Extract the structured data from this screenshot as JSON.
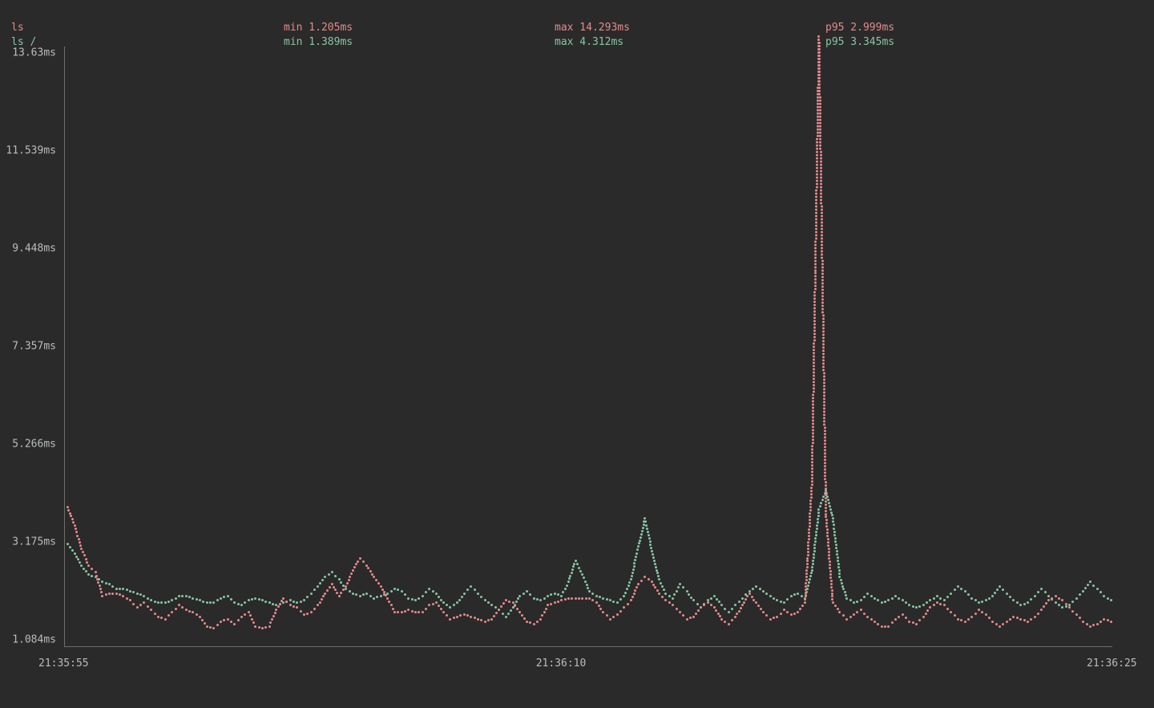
{
  "colors": {
    "ls": "#e38b8c",
    "ls_root": "#86c6a5"
  },
  "legend": {
    "rows": [
      {
        "name": "ls",
        "min": "min 1.205ms",
        "max": "max 14.293ms",
        "p95": "p95 2.999ms",
        "class": "c-ls"
      },
      {
        "name": "ls /",
        "min": "min 1.389ms",
        "max": "max 4.312ms",
        "p95": "p95 3.345ms",
        "class": "c-lsr"
      }
    ]
  },
  "yaxis": {
    "ticks": [
      "13.63ms",
      "11.539ms",
      "9.448ms",
      "7.357ms",
      "5.266ms",
      "3.175ms",
      "1.084ms"
    ]
  },
  "xaxis": {
    "ticks": [
      {
        "label": "21:35:55",
        "pos": "left"
      },
      {
        "label": "21:36:10",
        "pos": "center"
      },
      {
        "label": "21:36:25",
        "pos": "right"
      }
    ]
  },
  "chart_data": {
    "type": "line",
    "title": "",
    "xlabel": "",
    "ylabel": "",
    "ylim": [
      1.084,
      13.63
    ],
    "x_range": [
      "21:35:55",
      "21:36:25"
    ],
    "x_seconds": [
      0,
      0.2,
      0.4,
      0.6,
      0.8,
      1,
      1.2,
      1.4,
      1.6,
      1.8,
      2,
      2.2,
      2.4,
      2.6,
      2.8,
      3,
      3.2,
      3.4,
      3.6,
      3.8,
      4,
      4.2,
      4.4,
      4.6,
      4.8,
      5,
      5.2,
      5.4,
      5.6,
      5.8,
      6,
      6.2,
      6.4,
      6.6,
      6.8,
      7,
      7.2,
      7.4,
      7.6,
      7.8,
      8,
      8.2,
      8.4,
      8.6,
      8.8,
      9,
      9.2,
      9.4,
      9.6,
      9.8,
      10,
      10.2,
      10.4,
      10.6,
      10.8,
      11,
      11.2,
      11.4,
      11.6,
      11.8,
      12,
      12.2,
      12.4,
      12.6,
      12.8,
      13,
      13.2,
      13.4,
      13.6,
      13.8,
      14,
      14.2,
      14.4,
      14.6,
      14.8,
      15,
      15.2,
      15.4,
      15.6,
      15.8,
      16,
      16.2,
      16.4,
      16.6,
      16.8,
      17,
      17.2,
      17.4,
      17.6,
      17.8,
      18,
      18.2,
      18.4,
      18.6,
      18.8,
      19,
      19.2,
      19.4,
      19.6,
      19.8,
      20,
      20.2,
      20.4,
      20.6,
      20.8,
      21,
      21.2,
      21.4,
      21.6,
      21.8,
      22,
      22.2,
      22.4,
      22.6,
      22.8,
      23,
      23.2,
      23.4,
      23.6,
      23.8,
      24,
      24.2,
      24.4,
      24.6,
      24.8,
      25,
      25.2,
      25.4,
      25.6,
      25.8,
      26,
      26.2,
      26.4,
      26.6,
      26.8,
      27,
      27.2,
      27.4,
      27.6,
      27.8,
      28,
      28.2,
      28.4,
      28.6,
      28.8,
      29,
      29.2,
      29.4,
      29.6,
      29.8,
      30
    ],
    "series": [
      {
        "name": "ls",
        "color": "#e38b8c",
        "min": 1.205,
        "max": 14.293,
        "p95": 2.999,
        "values": [
          3.95,
          3.55,
          3.05,
          2.7,
          2.55,
          2.05,
          2.1,
          2.1,
          2.05,
          1.95,
          1.8,
          1.9,
          1.75,
          1.6,
          1.55,
          1.7,
          1.85,
          1.75,
          1.7,
          1.6,
          1.4,
          1.35,
          1.5,
          1.55,
          1.45,
          1.6,
          1.7,
          1.4,
          1.35,
          1.4,
          1.75,
          2.0,
          1.85,
          1.8,
          1.65,
          1.7,
          1.85,
          2.1,
          2.3,
          2.05,
          2.25,
          2.6,
          2.85,
          2.7,
          2.45,
          2.25,
          2.0,
          1.7,
          1.7,
          1.75,
          1.7,
          1.7,
          1.85,
          1.9,
          1.7,
          1.55,
          1.6,
          1.65,
          1.6,
          1.55,
          1.5,
          1.55,
          1.75,
          1.95,
          1.9,
          1.7,
          1.5,
          1.45,
          1.55,
          1.85,
          1.9,
          1.95,
          2.0,
          2.0,
          2.0,
          2.0,
          1.9,
          1.7,
          1.55,
          1.65,
          1.8,
          1.95,
          2.3,
          2.45,
          2.35,
          2.1,
          1.95,
          1.85,
          1.7,
          1.55,
          1.6,
          1.8,
          1.9,
          1.8,
          1.55,
          1.45,
          1.6,
          1.85,
          2.1,
          1.9,
          1.7,
          1.55,
          1.6,
          1.75,
          1.65,
          1.7,
          1.9,
          4.5,
          14.0,
          3.8,
          1.9,
          1.7,
          1.55,
          1.65,
          1.75,
          1.6,
          1.5,
          1.4,
          1.4,
          1.55,
          1.65,
          1.5,
          1.45,
          1.6,
          1.8,
          1.9,
          1.85,
          1.7,
          1.55,
          1.5,
          1.6,
          1.75,
          1.65,
          1.5,
          1.4,
          1.5,
          1.6,
          1.55,
          1.5,
          1.6,
          1.75,
          1.95,
          2.05,
          1.95,
          1.8,
          1.65,
          1.5,
          1.4,
          1.45,
          1.55,
          1.5
        ]
      },
      {
        "name": "ls /",
        "color": "#86c6a5",
        "min": 1.389,
        "max": 4.312,
        "p95": 3.345,
        "values": [
          3.15,
          2.95,
          2.7,
          2.5,
          2.45,
          2.35,
          2.3,
          2.2,
          2.2,
          2.15,
          2.1,
          2.05,
          1.95,
          1.9,
          1.9,
          1.95,
          2.05,
          2.05,
          2.0,
          1.95,
          1.9,
          1.9,
          2.0,
          2.05,
          1.9,
          1.85,
          1.95,
          2.0,
          1.95,
          1.9,
          1.85,
          1.9,
          1.95,
          1.9,
          1.95,
          2.1,
          2.25,
          2.45,
          2.55,
          2.4,
          2.2,
          2.1,
          2.05,
          2.1,
          2.0,
          2.05,
          2.1,
          2.2,
          2.15,
          2.0,
          1.95,
          2.05,
          2.2,
          2.1,
          1.9,
          1.8,
          1.9,
          2.1,
          2.25,
          2.1,
          1.95,
          1.85,
          1.75,
          1.6,
          1.8,
          2.05,
          2.15,
          2.0,
          1.95,
          2.05,
          2.1,
          2.05,
          2.35,
          2.8,
          2.5,
          2.15,
          2.05,
          2.0,
          1.95,
          1.9,
          2.05,
          2.4,
          3.1,
          3.7,
          3.0,
          2.4,
          2.1,
          2.0,
          2.3,
          2.15,
          1.95,
          1.8,
          1.95,
          2.05,
          1.85,
          1.7,
          1.85,
          2.0,
          2.15,
          2.25,
          2.15,
          2.05,
          1.95,
          1.9,
          2.05,
          2.1,
          2.0,
          2.6,
          3.9,
          4.3,
          3.7,
          2.45,
          2.0,
          1.9,
          1.95,
          2.1,
          2.0,
          1.9,
          1.95,
          2.05,
          1.95,
          1.85,
          1.8,
          1.85,
          1.95,
          2.05,
          1.95,
          2.1,
          2.25,
          2.15,
          2.0,
          1.9,
          1.95,
          2.05,
          2.25,
          2.1,
          1.95,
          1.85,
          1.9,
          2.05,
          2.2,
          2.05,
          1.9,
          1.8,
          1.85,
          2.0,
          2.15,
          2.35,
          2.2,
          2.05,
          1.95
        ]
      }
    ]
  }
}
